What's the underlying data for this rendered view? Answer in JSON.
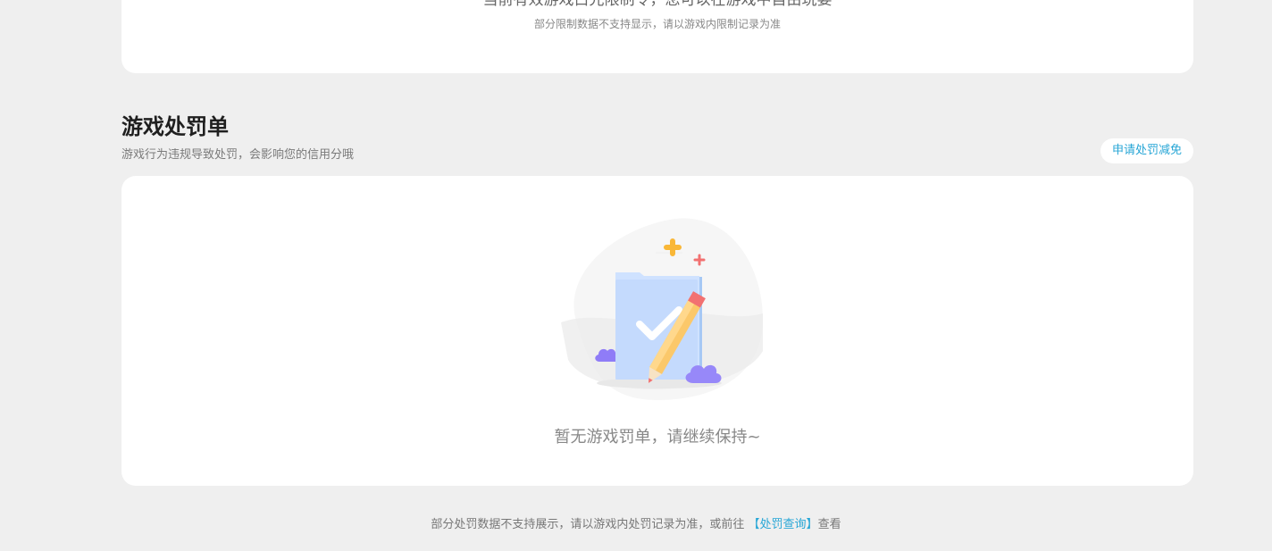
{
  "top_card": {
    "cut_text": "当前有效游戏白光限制令，您可以在游戏中自由玩耍",
    "note": "部分限制数据不支持显示，请以游戏内限制记录为准"
  },
  "penalty_section": {
    "title": "游戏处罚单",
    "subtitle": "游戏行为违规导致处罚，会影响您的信用分哦",
    "appeal_button": "申请处罚减免",
    "empty_text": "暂无游戏罚单，请继续保持~",
    "illustration_icon": "empty-document-check-pencil-icon"
  },
  "footer": {
    "text_before": "部分处罚数据不支持展示，请以游戏内处罚记录为准，或前往 ",
    "link_text": "【处罚查询】",
    "text_after": "查看"
  },
  "colors": {
    "page_bg": "#efefef",
    "card_bg": "#ffffff",
    "accent": "#27a6d6",
    "doc_blue": "#bcd6ff",
    "pencil_yellow": "#fbc86a",
    "cloud_purple": "#8f7cf7",
    "sparkle_orange": "#f9b737",
    "sparkle_red": "#f27171"
  }
}
